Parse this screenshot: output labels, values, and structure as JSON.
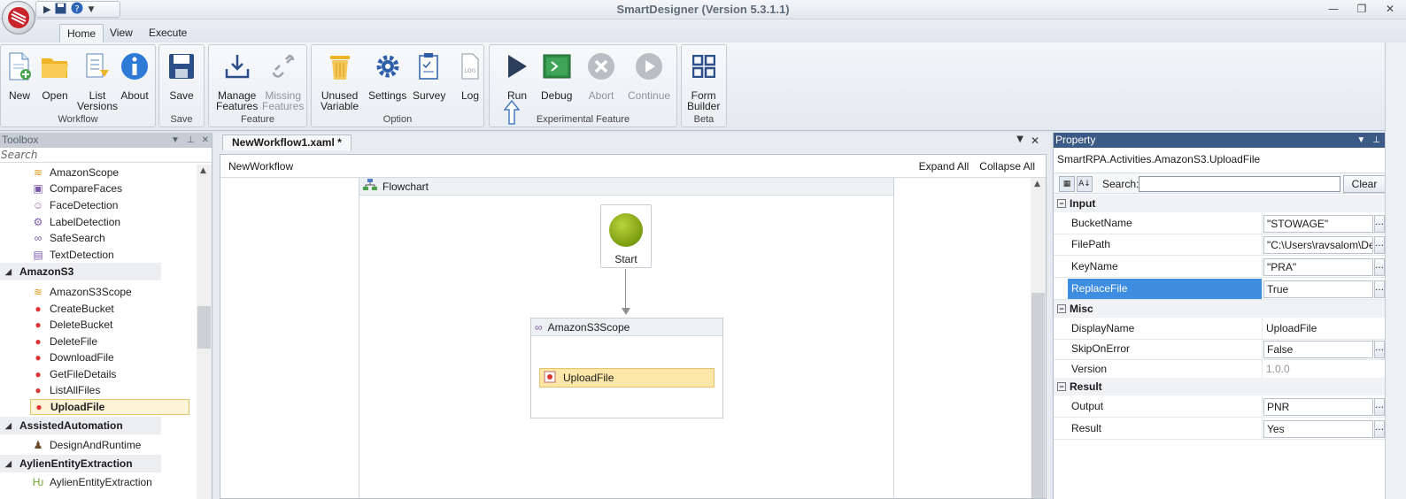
{
  "window": {
    "title": "SmartDesigner (Version 5.3.1.1)"
  },
  "ribbon": {
    "tabs": [
      {
        "label": "Home"
      },
      {
        "label": "View"
      },
      {
        "label": "Execute"
      }
    ],
    "groups": {
      "workflow": {
        "label": "Workflow",
        "buttons": {
          "new": "New",
          "open": "Open",
          "list_versions_1": "List",
          "list_versions_2": "Versions",
          "about": "About"
        }
      },
      "save": {
        "label": "Save",
        "buttons": {
          "save": "Save"
        }
      },
      "feature": {
        "label": "Feature",
        "buttons": {
          "manage_1": "Manage",
          "manage_2": "Features",
          "missing_1": "Missing",
          "missing_2": "Features"
        }
      },
      "option": {
        "label": "Option",
        "buttons": {
          "unused_1": "Unused",
          "unused_2": "Variable",
          "settings": "Settings",
          "survey": "Survey",
          "log": "Log"
        }
      },
      "experimental": {
        "label": "Experimental Feature",
        "buttons": {
          "run": "Run",
          "debug": "Debug",
          "abort": "Abort",
          "continue": "Continue"
        }
      },
      "beta": {
        "label": "Beta",
        "buttons": {
          "form_1": "Form",
          "form_2": "Builder"
        }
      }
    }
  },
  "toolbox": {
    "title": "Toolbox",
    "search_placeholder": "Search",
    "items": [
      "AmazonScope",
      "CompareFaces",
      "FaceDetection",
      "LabelDetection",
      "SafeSearch",
      "TextDetection"
    ],
    "groups": {
      "amazons3": {
        "label": "AmazonS3",
        "items": [
          "AmazonS3Scope",
          "CreateBucket",
          "DeleteBucket",
          "DeleteFile",
          "DownloadFile",
          "GetFileDetails",
          "ListAllFiles",
          "UploadFile"
        ]
      },
      "assisted": {
        "label": "AssistedAutomation",
        "items": [
          "DesignAndRuntime"
        ]
      },
      "aylien": {
        "label": "AylienEntityExtraction",
        "items": [
          "AylienEntityExtraction"
        ]
      }
    }
  },
  "designer": {
    "doc_tab": "NewWorkflow1.xaml *",
    "breadcrumb": "NewWorkflow",
    "expand_all": "Expand All",
    "collapse_all": "Collapse All",
    "flowchart_label": "Flowchart",
    "start_label": "Start",
    "scope_label": "AmazonS3Scope",
    "activity_label": "UploadFile"
  },
  "property": {
    "title": "Property",
    "type": "SmartRPA.Activities.AmazonS3.UploadFile",
    "search_label": "Search:",
    "clear_label": "Clear",
    "categories": {
      "input": "Input",
      "misc": "Misc",
      "result": "Result"
    },
    "rows": {
      "bucket_name": {
        "name": "BucketName",
        "value": "\"STOWAGE\""
      },
      "file_path": {
        "name": "FilePath",
        "value": "\"C:\\Users\\ravsalom\\De"
      },
      "key_name": {
        "name": "KeyName",
        "value": "\"PRA\""
      },
      "replace_file": {
        "name": "ReplaceFile",
        "value": "True"
      },
      "display_name": {
        "name": "DisplayName",
        "value": "UploadFile"
      },
      "skip_on_error": {
        "name": "SkipOnError",
        "value": "False"
      },
      "version": {
        "name": "Version",
        "value": "1.0.0"
      },
      "output": {
        "name": "Output",
        "value": "PNR"
      },
      "result": {
        "name": "Result",
        "value": "Yes"
      }
    }
  },
  "colors": {
    "accent": "#3c5a86",
    "selection": "#3e8de0",
    "activity_highlight": "#fde7a8",
    "start_node": "#7a9c10"
  }
}
